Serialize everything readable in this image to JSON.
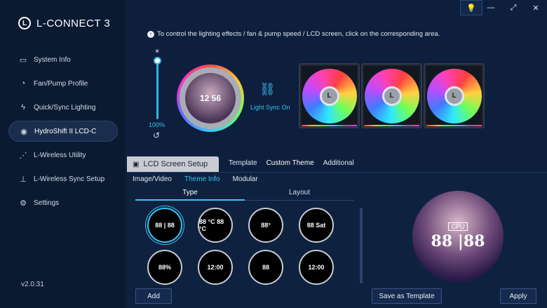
{
  "app": {
    "title": "L-CONNECT 3",
    "version": "v2.0.31",
    "accent": "#39c2f0"
  },
  "sidebar": {
    "items": [
      {
        "label": "System Info",
        "icon": "monitor-icon"
      },
      {
        "label": "Fan/Pump Profile",
        "icon": "gauge-icon"
      },
      {
        "label": "Quick/Sync Lighting",
        "icon": "lightning-icon"
      },
      {
        "label": "HydroShift II LCD-C",
        "icon": "pump-icon",
        "active": true
      },
      {
        "label": "L-Wireless Utility",
        "icon": "wireless-icon"
      },
      {
        "label": "L-Wireless Sync Setup",
        "icon": "wireless-sync-icon"
      },
      {
        "label": "Settings",
        "icon": "gear-icon"
      }
    ]
  },
  "header": {
    "hint": "To control the lighting effects / fan & pump speed / LCD screen, click on the corresponding area.",
    "brightness": "100%",
    "sync_label": "Light Sync On",
    "pump_lcd": "12 56"
  },
  "tabs": {
    "lcd": "LCD Screen Setup",
    "top": [
      "Template",
      "Custom Theme",
      "Additional"
    ],
    "sub": [
      "Image/Video",
      "Theme Info",
      "Modular"
    ],
    "type": "Type",
    "layout": "Layout"
  },
  "thumbs": [
    "88 | 88",
    "88 °C 88 °C",
    "88°",
    "88 Sat",
    "88%",
    "12:00",
    "88",
    "12:00"
  ],
  "preview": {
    "cpu": "CPU",
    "nums": "88 |88"
  },
  "buttons": {
    "add": "Add",
    "save_template": "Save as Template",
    "apply": "Apply"
  }
}
